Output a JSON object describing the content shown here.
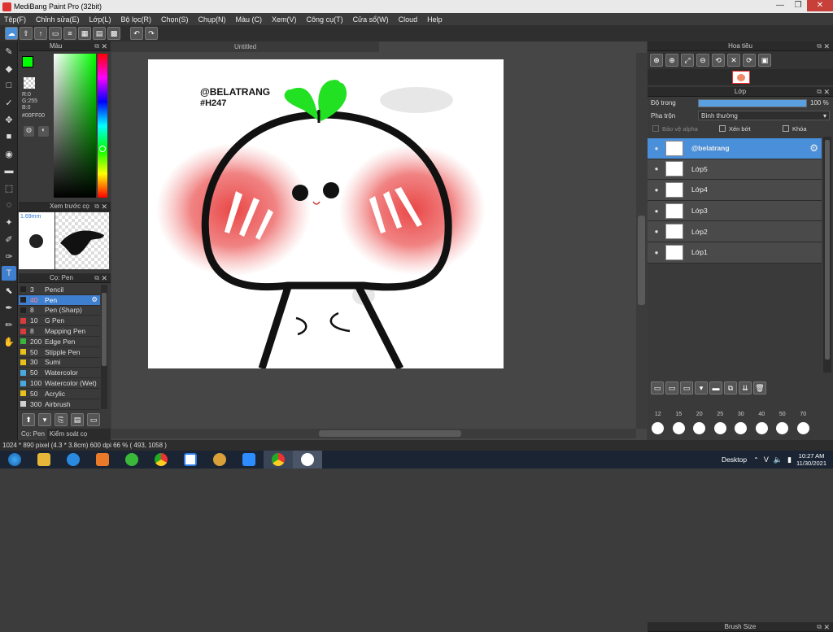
{
  "window": {
    "title": "MediBang Paint Pro (32bit)",
    "minimize": "—",
    "maximize": "❐",
    "close": "✕"
  },
  "menu": [
    "Tệp(F)",
    "Chỉnh sửa(E)",
    "Lớp(L)",
    "Bộ lọc(R)",
    "Chọn(S)",
    "Chụp(N)",
    "Màu (C)",
    "Xem(V)",
    "Công cụ(T)",
    "Cửa sổ(W)",
    "Cloud",
    "Help"
  ],
  "color_panel": {
    "title": "Màu",
    "r": "R:0",
    "g": "G:255",
    "b": "B:0",
    "hex": "#00FF00",
    "primary_color": "#00ff00"
  },
  "brush_preview": {
    "title": "Xem trước cọ",
    "size": "1.69mm"
  },
  "brush_panel": {
    "title": "Cọ: Pen",
    "items": [
      {
        "size": "3",
        "name": "Pencil",
        "color": "#222222"
      },
      {
        "size": "40",
        "name": "Pen",
        "color": "#222222",
        "selected": true
      },
      {
        "size": "8",
        "name": "Pen (Sharp)",
        "color": "#222222"
      },
      {
        "size": "10",
        "name": "G Pen",
        "color": "#d93c3c"
      },
      {
        "size": "8",
        "name": "Mapping Pen",
        "color": "#d93c3c"
      },
      {
        "size": "200",
        "name": "Edge Pen",
        "color": "#3cb43c"
      },
      {
        "size": "50",
        "name": "Stipple Pen",
        "color": "#e8c21a"
      },
      {
        "size": "30",
        "name": "Sumi",
        "color": "#e8c21a"
      },
      {
        "size": "50",
        "name": "Watercolor",
        "color": "#4aa8e0"
      },
      {
        "size": "100",
        "name": "Watercolor (Wet)",
        "color": "#4aa8e0"
      },
      {
        "size": "50",
        "name": "Acrylic",
        "color": "#e8c21a"
      },
      {
        "size": "300",
        "name": "Airbrush",
        "color": "#d0d0d0"
      }
    ]
  },
  "bottom_tabs": [
    "Cọ: Pen",
    "Kiểm soát cọ"
  ],
  "document": {
    "tab_title": "Untitled",
    "text_line1": "@BELATRANG",
    "text_line2": "#H247"
  },
  "navigator": {
    "title": "Hoa tiêu"
  },
  "layers_panel": {
    "title": "Lớp",
    "opacity_label": "Độ trong",
    "opacity_value": "100 %",
    "opacity": 1.0,
    "blend_label": "Pha trộn",
    "blend_value": "Bình thường",
    "protect_alpha": "Bảo vệ alpha",
    "clipping": "Xén bớt",
    "lock": "Khóa",
    "layers": [
      {
        "name": "@belatrang",
        "selected": true
      },
      {
        "name": "Lớp5"
      },
      {
        "name": "Lớp4"
      },
      {
        "name": "Lớp3"
      },
      {
        "name": "Lớp2"
      },
      {
        "name": "Lớp1"
      }
    ]
  },
  "brush_size_panel": {
    "title": "Brush Size",
    "sizes": [
      "12",
      "15",
      "20",
      "25",
      "30",
      "40",
      "50",
      "70"
    ]
  },
  "status": {
    "text": "1024 * 890 pixel  (4.3 * 3.8cm)  600 dpi  66 %  ( 493, 1058 )"
  },
  "taskbar": {
    "desktop": "Desktop",
    "time": "10:27 AM",
    "date": "11/30/2021",
    "lang": "V"
  }
}
